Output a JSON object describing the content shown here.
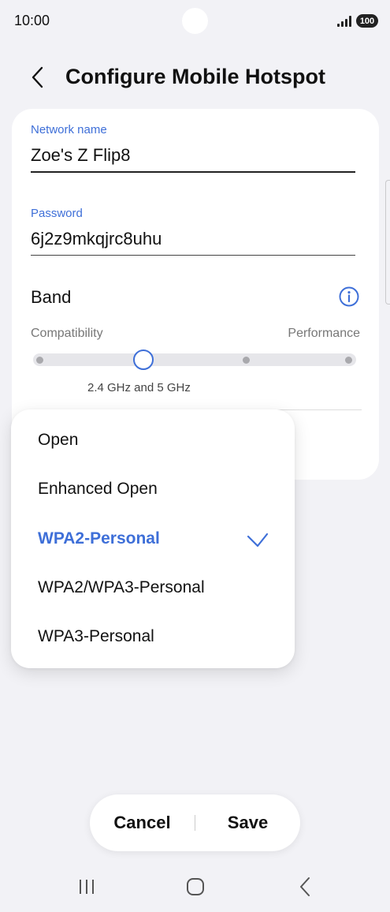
{
  "status_bar": {
    "time": "10:00",
    "battery": "100"
  },
  "header": {
    "title": "Configure Mobile Hotspot",
    "back_icon": "chevron-left-icon"
  },
  "form": {
    "network_name": {
      "label": "Network name",
      "value": "Zoe's Z Flip8"
    },
    "password": {
      "label": "Password",
      "value": "6j2z9mkqjrc8uhu"
    },
    "band": {
      "label": "Band",
      "info_icon": "info-icon",
      "scale_min_label": "Compatibility",
      "scale_max_label": "Performance",
      "levels": 4,
      "selected_level": 2,
      "selected_value": "2.4 GHz and 5 GHz"
    }
  },
  "security_dropdown": {
    "options": [
      {
        "label": "Open",
        "selected": false
      },
      {
        "label": "Enhanced Open",
        "selected": false
      },
      {
        "label": "WPA2-Personal",
        "selected": true
      },
      {
        "label": "WPA2/WPA3-Personal",
        "selected": false
      },
      {
        "label": "WPA3-Personal",
        "selected": false
      }
    ],
    "check_icon": "checkmark-icon"
  },
  "actions": {
    "cancel_label": "Cancel",
    "save_label": "Save"
  },
  "colors": {
    "accent": "#3e6fd8",
    "background": "#f2f2f6",
    "card": "#ffffff"
  }
}
